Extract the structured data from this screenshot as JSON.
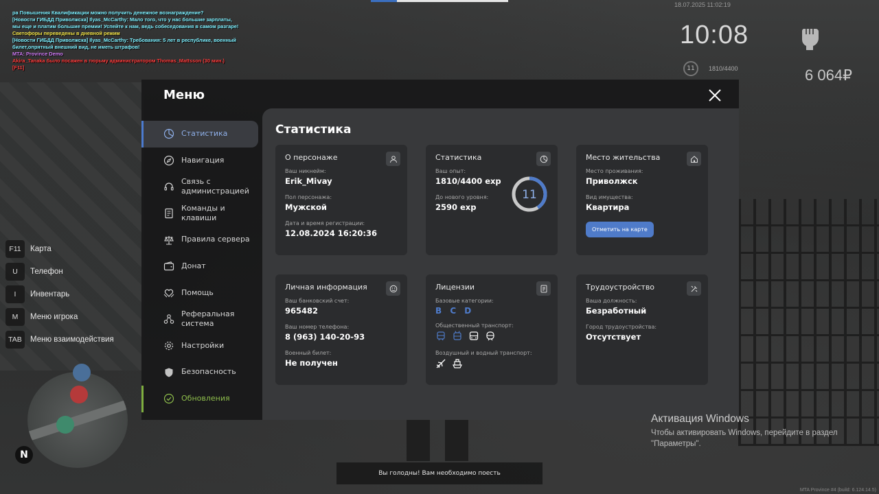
{
  "chat": [
    {
      "text": "ра Повышения Квалификации можно получить денежное вознаграждение?",
      "color": "#7ef0ff"
    },
    {
      "text": "[Новости ГИБДД Приволжска] Ilyas_McCarthy: Мало того, что у нас большие зарплаты, мы еще и платим большие премии! Успейте к нам, ведь собеседования в самом разгаре!",
      "color": "#7ef0ff"
    },
    {
      "text": "Светофоры переведены в дневной режим",
      "color": "#f5e64a"
    },
    {
      "text": "[Новости ГИБДД Приволжска] Ilyas_McCarthy: Требования: 5 лет в республике, военный билет,опрятный внешний вид, не иметь штрафов!",
      "color": "#7ef0ff"
    },
    {
      "text": "MTA: Province Demo",
      "color": "#d07bf5"
    },
    {
      "text": "Akira_Tanaka было посажен в тюрьму администратором Thomas_Mattsson (30 мин.)",
      "color": "#ff3b3b"
    },
    {
      "text": "[F11]",
      "color": "#ff3b3b"
    }
  ],
  "hud": {
    "datetime": "18.07.2025 11:02:19",
    "clock": "10:08",
    "level": "11",
    "exp": "1810/4400",
    "money": "6 064₽"
  },
  "hotkeys": [
    {
      "key": "F11",
      "label": "Карта"
    },
    {
      "key": "U",
      "label": "Телефон"
    },
    {
      "key": "I",
      "label": "Инвентарь"
    },
    {
      "key": "M",
      "label": "Меню игрока"
    },
    {
      "key": "TAB",
      "label": "Меню взаимодействия"
    }
  ],
  "minimap": {
    "north": "N"
  },
  "menu": {
    "title": "Меню",
    "nav": [
      {
        "label": "Статистика",
        "icon": "pie-chart-icon"
      },
      {
        "label": "Навигация",
        "icon": "compass-icon"
      },
      {
        "label": "Связь с администрацией",
        "icon": "headset-icon"
      },
      {
        "label": "Команды и клавиши",
        "icon": "document-icon"
      },
      {
        "label": "Правила сервера",
        "icon": "scales-icon"
      },
      {
        "label": "Донат",
        "icon": "wallet-icon"
      },
      {
        "label": "Помощь",
        "icon": "heart-hands-icon"
      },
      {
        "label": "Реферальная система",
        "icon": "referral-icon"
      },
      {
        "label": "Настройки",
        "icon": "gear-icon"
      },
      {
        "label": "Безопасность",
        "icon": "shield-icon"
      },
      {
        "label": "Обновления",
        "icon": "check-circle-icon"
      }
    ],
    "active_index": 0,
    "content_title": "Статистика",
    "cards": {
      "person": {
        "title": "О персонаже",
        "nick_label": "Ваш никнейм:",
        "nick": "Erik_Mivay",
        "gender_label": "Пол персонажа:",
        "gender": "Мужской",
        "reg_label": "Дата и время регистрации:",
        "reg": "12.08.2024 16:20:36"
      },
      "stats": {
        "title": "Статистика",
        "exp_label": "Ваш опыт:",
        "exp": "1810/4400 exp",
        "next_label": "До нового уровня:",
        "next": "2590 exp",
        "level": "11",
        "exp_current": 1810,
        "exp_max": 4400
      },
      "residence": {
        "title": "Место жительства",
        "place_label": "Место проживания:",
        "place": "Приволжск",
        "prop_label": "Вид имущества:",
        "prop": "Квартира",
        "button": "Отметить на карте"
      },
      "personal": {
        "title": "Личная информация",
        "bank_label": "Ваш банковский счет:",
        "bank": "965482",
        "phone_label": "Ваш номер телефона:",
        "phone": "8 (963) 140-20-93",
        "mil_label": "Военный билет:",
        "mil": "Не получен"
      },
      "licenses": {
        "title": "Лицензии",
        "base_label": "Базовые категории:",
        "base": "B C D",
        "public_label": "Общественный транспорт:",
        "air_label": "Воздушный и водный транспорт:"
      },
      "job": {
        "title": "Трудоустройство",
        "pos_label": "Ваша должность:",
        "pos": "Безработный",
        "city_label": "Город трудоустройства:",
        "city": "Отсутствует"
      }
    }
  },
  "notice": "Вы голодны! Вам необходимо поесть",
  "watermark": {
    "title": "Активация Windows",
    "text": "Чтобы активировать Windows, перейдите в раздел \"Параметры\"."
  },
  "build": "MTA Province #4 (build: 6.124.14.5)",
  "colors": {
    "accent": "#4f7bc9",
    "green": "#8fbf4c",
    "panel": "#38393b",
    "card": "#2b2c2e"
  }
}
